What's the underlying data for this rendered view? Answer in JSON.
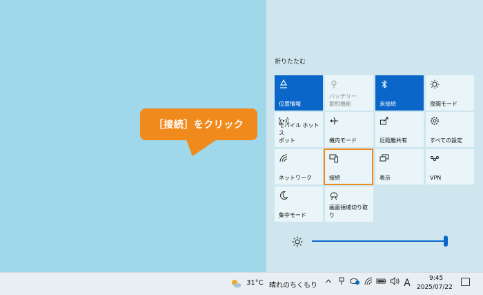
{
  "panel": {
    "collapse_label": "折りたたむ"
  },
  "tiles": [
    {
      "label": "位置情報",
      "icon": "location-icon",
      "state": "on"
    },
    {
      "label": "バッテリー\n節約機能",
      "icon": "battery-saver-icon",
      "state": "dim"
    },
    {
      "label": "未接続",
      "icon": "bluetooth-icon",
      "state": "on"
    },
    {
      "label": "夜間モード",
      "icon": "night-light-icon",
      "state": "off"
    },
    {
      "label": "モバイル ホットス\nポット",
      "icon": "mobile-hotspot-icon",
      "state": "off"
    },
    {
      "label": "機内モード",
      "icon": "airplane-icon",
      "state": "off"
    },
    {
      "label": "近距離共有",
      "icon": "nearby-share-icon",
      "state": "off"
    },
    {
      "label": "すべての設定",
      "icon": "gear-icon",
      "state": "off"
    },
    {
      "label": "ネットワーク",
      "icon": "network-icon",
      "state": "off"
    },
    {
      "label": "接続",
      "icon": "connect-icon",
      "state": "off"
    },
    {
      "label": "表示",
      "icon": "project-icon",
      "state": "off"
    },
    {
      "label": "VPN",
      "icon": "vpn-icon",
      "state": "off"
    },
    {
      "label": "集中モード",
      "icon": "focus-moon-icon",
      "state": "off"
    },
    {
      "label": "画面領域切り取\nり",
      "icon": "snip-icon",
      "state": "off"
    }
  ],
  "callout": {
    "text": "［接続］をクリック"
  },
  "brightness": {
    "level_percent": 100
  },
  "taskbar": {
    "weather_temp": "31°C",
    "weather_desc": "晴れのちくもり",
    "ime": "A",
    "time": "9:45",
    "date": "2025/07/22"
  },
  "colors": {
    "accent": "#0a66c8",
    "highlight": "#f08a1c",
    "desktop": "#9ed8ea",
    "panel": "#cfe6ee"
  }
}
